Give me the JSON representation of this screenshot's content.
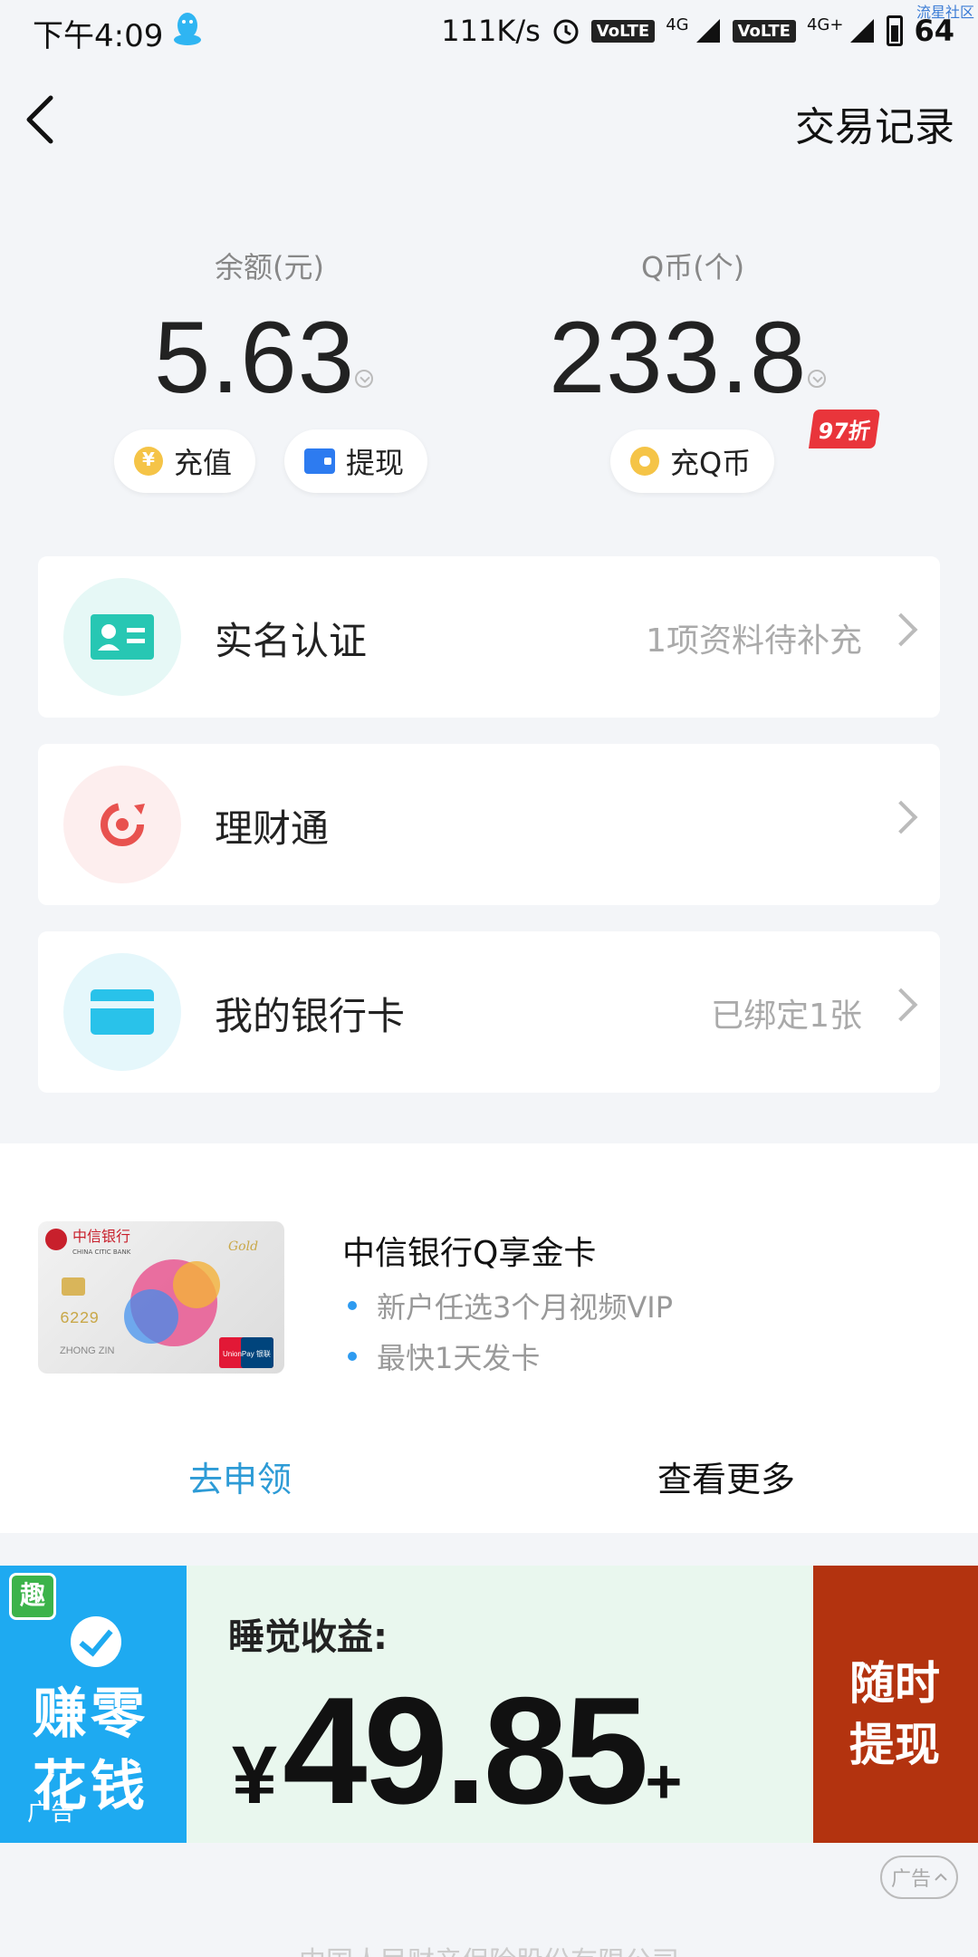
{
  "status_bar": {
    "time": "下午4:09",
    "net_speed": "111K/s",
    "volte_1": "VoLTE",
    "signal_1": "4G",
    "volte_2": "VoLTE",
    "signal_2": "4G+",
    "battery": "64",
    "watermark": "流星社区"
  },
  "header": {
    "transaction_record": "交易记录"
  },
  "balance": {
    "label": "余额(元)",
    "value": "5.63",
    "recharge": "充值",
    "recharge_icon_glyph": "¥",
    "withdraw": "提现"
  },
  "qcoin": {
    "label": "Q币(个)",
    "value": "233.8",
    "recharge": "充Q币",
    "discount_badge": "97折"
  },
  "cards": [
    {
      "title": "实名认证",
      "right_text": "1项资料待补充",
      "icon": "id-card-icon",
      "icon_bg": "#e6f8f6",
      "icon_color": "#27c7b3"
    },
    {
      "title": "理财通",
      "right_text": "",
      "icon": "wealth-icon",
      "icon_bg": "#fdeeee",
      "icon_color": "#e8524f"
    },
    {
      "title": "我的银行卡",
      "right_text": "已绑定1张",
      "icon": "bank-card-icon",
      "icon_bg": "#e5f7fb",
      "icon_color": "#29c2ea"
    }
  ],
  "promo": {
    "title": "中信银行Q享金卡",
    "bullets": [
      "新户任选3个月视频VIP",
      "最快1天发卡"
    ],
    "apply": "去申领",
    "more": "查看更多",
    "card_bank_name": "中信银行",
    "card_bank_en": "CHINA CITIC BANK",
    "card_number_fragment": "6229",
    "card_name": "ZHONG ZIN",
    "card_type": "Gold",
    "card_brand": "UnionPay 银联"
  },
  "ad": {
    "badge": "趣",
    "left_text": "赚零花钱",
    "left_label": "广告",
    "subtitle": "睡觉收益:",
    "currency": "¥",
    "amount": "49.85",
    "plus": "+",
    "right_text": "随时提现"
  },
  "ad_tag": "广告",
  "footer": "中国人民财产保险股份有限公司"
}
